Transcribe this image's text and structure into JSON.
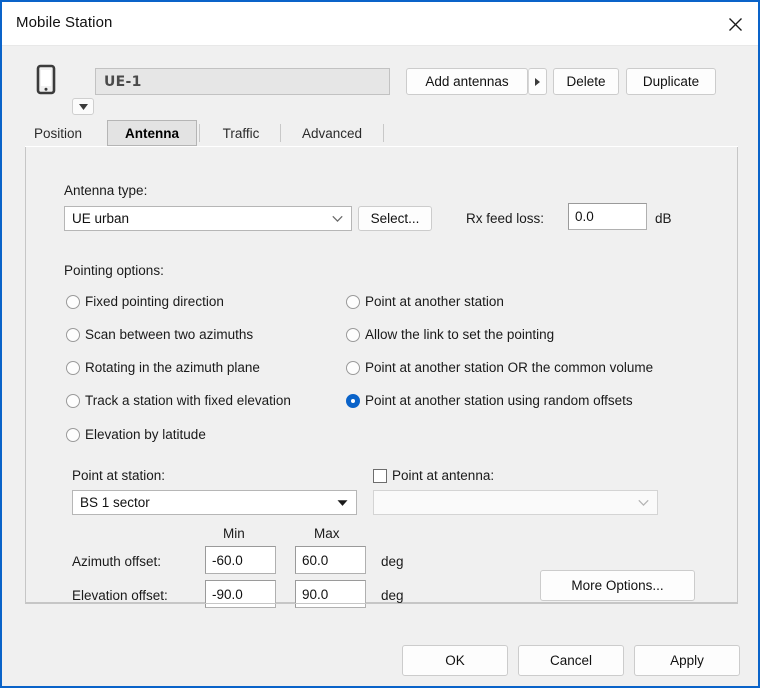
{
  "window": {
    "title": "Mobile Station",
    "close_icon": "close-icon",
    "accent_color": "#0a63c9",
    "background_color": "#f0f0f0"
  },
  "header": {
    "station_icon": "mobile-phone-icon",
    "dropdown_icon": "chevron-down-icon",
    "name_value": "UE-1",
    "buttons": {
      "add_antennas": "Add antennas",
      "add_antennas_arrow_icon": "caret-right-icon",
      "delete": "Delete",
      "duplicate": "Duplicate"
    }
  },
  "tabs": [
    {
      "label": "Position",
      "active": false
    },
    {
      "label": "Antenna",
      "active": true
    },
    {
      "label": "Traffic",
      "active": false
    },
    {
      "label": "Advanced",
      "active": false
    }
  ],
  "antenna": {
    "type_label": "Antenna type:",
    "type_value": "UE urban",
    "type_chevron_icon": "chevron-down-icon",
    "select_button": "Select...",
    "rx_feed_loss_label": "Rx feed loss:",
    "rx_feed_loss_value": "0.0",
    "rx_feed_loss_unit": "dB"
  },
  "pointing": {
    "group_label": "Pointing options:",
    "options_left": [
      {
        "label": "Fixed pointing direction",
        "selected": false
      },
      {
        "label": "Scan between two azimuths",
        "selected": false
      },
      {
        "label": "Rotating in the azimuth plane",
        "selected": false
      },
      {
        "label": "Track a station with fixed elevation",
        "selected": false
      },
      {
        "label": "Elevation by latitude",
        "selected": false
      }
    ],
    "options_right": [
      {
        "label": "Point at another station",
        "selected": false
      },
      {
        "label": "Allow the link to set the pointing",
        "selected": false
      },
      {
        "label": "Point at another station OR the common volume",
        "selected": false
      },
      {
        "label": "Point at another station using random offsets",
        "selected": true
      }
    ]
  },
  "target": {
    "point_at_station_label": "Point at station:",
    "point_at_station_value": "BS 1 sector",
    "point_at_station_chevron_icon": "caret-down-icon",
    "point_at_antenna_label": "Point at antenna:",
    "point_at_antenna_checked": false,
    "point_at_antenna_value": "",
    "point_at_antenna_chevron_icon": "chevron-down-icon"
  },
  "offsets": {
    "col_min": "Min",
    "col_max": "Max",
    "rows": [
      {
        "label": "Azimuth offset:",
        "min": "-60.0",
        "max": "60.0",
        "unit": "deg"
      },
      {
        "label": "Elevation offset:",
        "min": "-90.0",
        "max": "90.0",
        "unit": "deg"
      }
    ],
    "more_options_button": "More Options..."
  },
  "footer": {
    "ok": "OK",
    "cancel": "Cancel",
    "apply": "Apply"
  }
}
